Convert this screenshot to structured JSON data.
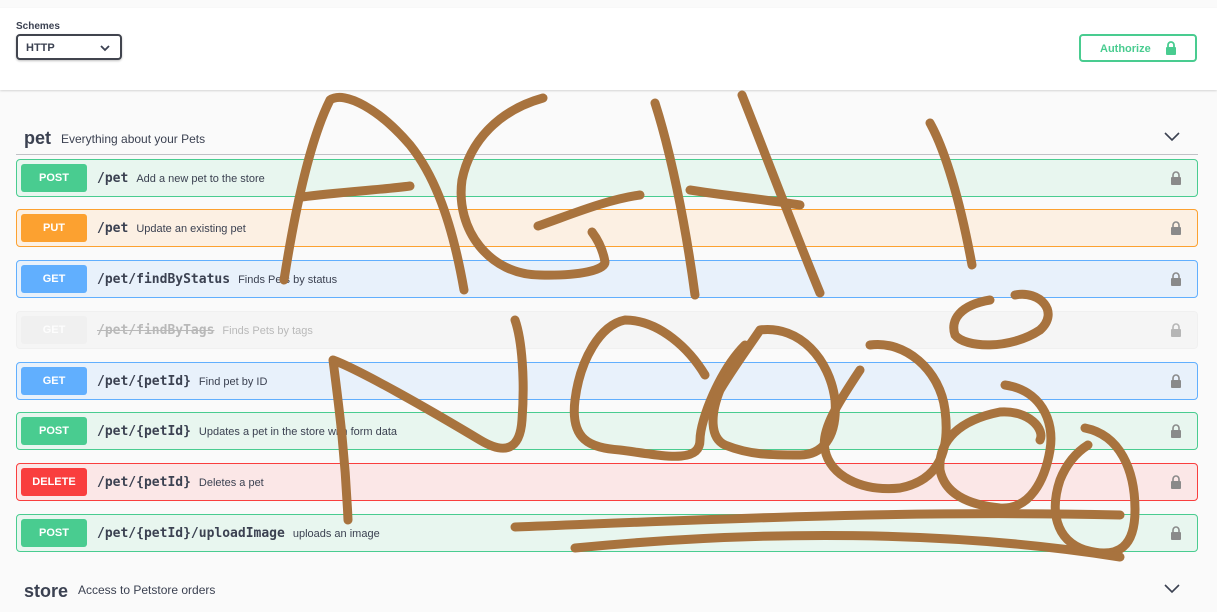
{
  "header": {
    "schemes_label": "Schemes",
    "scheme_value": "HTTP",
    "authorize_label": "Authorize"
  },
  "tags": [
    {
      "name": "pet",
      "description": "Everything about your Pets"
    },
    {
      "name": "store",
      "description": "Access to Petstore orders"
    }
  ],
  "operations": [
    {
      "method": "POST",
      "path": "/pet",
      "summary": "Add a new pet to the store"
    },
    {
      "method": "PUT",
      "path": "/pet",
      "summary": "Update an existing pet"
    },
    {
      "method": "GET",
      "path": "/pet/findByStatus",
      "summary": "Finds Pets by status"
    },
    {
      "method": "GET",
      "path": "/pet/findByTags",
      "summary": "Finds Pets by tags",
      "deprecated": true
    },
    {
      "method": "GET",
      "path": "/pet/{petId}",
      "summary": "Find pet by ID"
    },
    {
      "method": "POST",
      "path": "/pet/{petId}",
      "summary": "Updates a pet in the store with form data"
    },
    {
      "method": "DELETE",
      "path": "/pet/{petId}",
      "summary": "Deletes a pet"
    },
    {
      "method": "POST",
      "path": "/pet/{petId}/uploadImage",
      "summary": "uploads an image"
    }
  ],
  "annotation": {
    "text": "AGH! NOOOO",
    "color": "#a8733e"
  },
  "colors": {
    "post": "#49cc90",
    "put": "#fca130",
    "get": "#61affe",
    "delete": "#f93e3e",
    "deprecated": "#ebebeb"
  },
  "icons": {
    "select_chevron": "chevron-down-icon",
    "authorize": "lock-icon",
    "operation_lock": "lock-icon",
    "tag_toggle": "chevron-down-icon"
  }
}
